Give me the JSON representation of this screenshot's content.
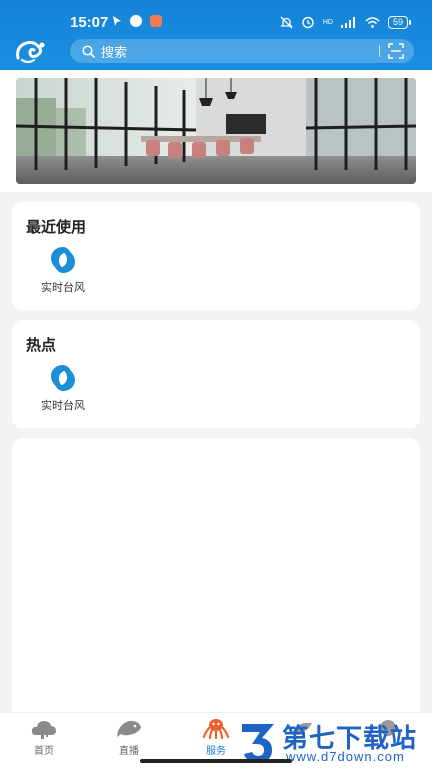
{
  "status_bar": {
    "time": "15:07",
    "battery": "59",
    "network": "HD"
  },
  "search": {
    "placeholder": "搜索"
  },
  "recent": {
    "title": "最近使用",
    "items": [
      {
        "label": "实时台风",
        "icon": "typhoon-icon"
      }
    ]
  },
  "hot": {
    "title": "热点",
    "items": [
      {
        "label": "实时台风",
        "icon": "typhoon-icon"
      }
    ]
  },
  "nav": [
    {
      "label": "首页",
      "icon": "cloud-home-icon"
    },
    {
      "label": "直播",
      "icon": "fish-live-icon"
    },
    {
      "label": "服务",
      "icon": "octopus-service-icon",
      "active": true
    },
    {
      "label": "",
      "icon": "nav-4-icon"
    },
    {
      "label": "",
      "icon": "nav-5-icon"
    }
  ],
  "watermark": {
    "main": "第七下载站",
    "sub": "www.d7down.com"
  },
  "colors": {
    "header": "#1a8fe2",
    "accent": "#1a7fd0",
    "typhoon": "#1a8fd8"
  }
}
